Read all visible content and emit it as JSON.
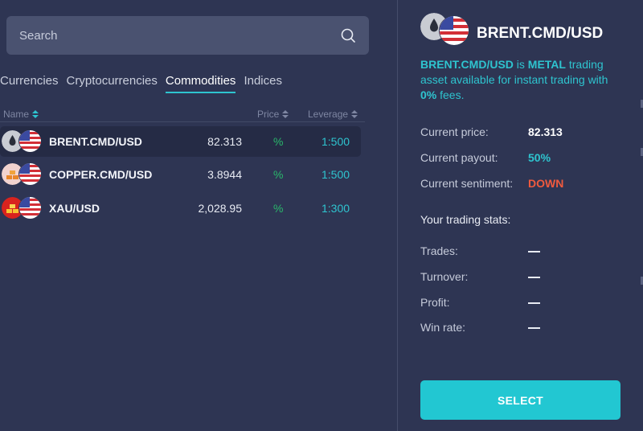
{
  "search": {
    "placeholder": "Search"
  },
  "tabs": [
    {
      "label": "Currencies",
      "active": false
    },
    {
      "label": "Cryptocurrencies",
      "active": false
    },
    {
      "label": "Commodities",
      "active": true
    },
    {
      "label": "Indices",
      "active": false
    }
  ],
  "table": {
    "headers": {
      "name": "Name",
      "price": "Price",
      "leverage": "Leverage"
    },
    "rows": [
      {
        "symbol": "BRENT.CMD/USD",
        "price": "82.313",
        "pct": "%",
        "leverage": "1:500",
        "icon": "oil-drop-icon",
        "selected": true
      },
      {
        "symbol": "COPPER.CMD/USD",
        "price": "3.8944",
        "pct": "%",
        "leverage": "1:500",
        "icon": "copper-bars-icon",
        "selected": false
      },
      {
        "symbol": "XAU/USD",
        "price": "2,028.95",
        "pct": "%",
        "leverage": "1:300",
        "icon": "gold-bars-icon",
        "selected": false
      }
    ]
  },
  "detail": {
    "title": "BRENT.CMD/USD",
    "desc_symbol": "BRENT.CMD/USD",
    "desc_is": " is ",
    "desc_type": "METAL",
    "desc_mid": " trading asset available for instant trading with ",
    "desc_fee": "0%",
    "desc_end": " fees.",
    "current_price_label": "Current price:",
    "current_price": "82.313",
    "current_payout_label": "Current payout:",
    "current_payout": "50%",
    "current_sentiment_label": "Current sentiment:",
    "current_sentiment": "DOWN",
    "stats_heading": "Your trading stats:",
    "trades_label": "Trades:",
    "turnover_label": "Turnover:",
    "profit_label": "Profit:",
    "winrate_label": "Win rate:",
    "select_label": "SELECT"
  },
  "colors": {
    "background": "#2e3553",
    "accent": "#2ec4cf",
    "positive": "#29b86b",
    "negative": "#f05a3e"
  }
}
